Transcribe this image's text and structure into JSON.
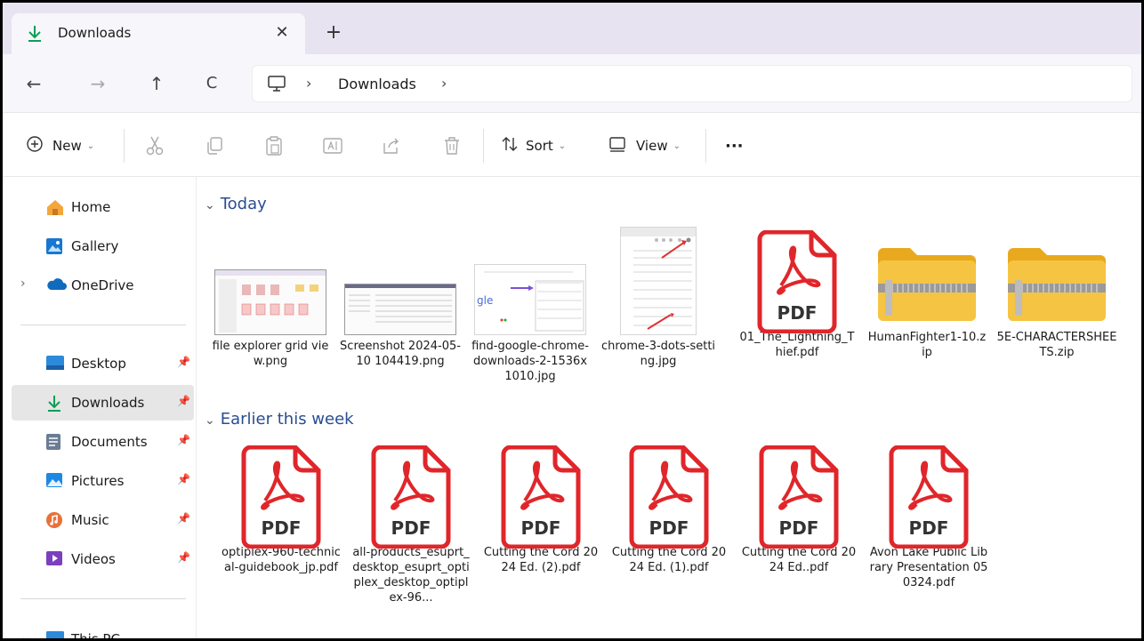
{
  "window": {
    "tab_label": "Downloads",
    "tab_close": "✕",
    "tab_new": "+"
  },
  "nav": {
    "back": "←",
    "forward": "→",
    "up": "↑",
    "refresh": "C",
    "address_segment": "Downloads",
    "chevron": "›"
  },
  "toolbar": {
    "new_label": "New",
    "sort_label": "Sort",
    "view_label": "View",
    "more_label": "···",
    "caret": "⌄"
  },
  "sidebar": {
    "items": [
      {
        "label": "Home",
        "icon": "home-icon"
      },
      {
        "label": "Gallery",
        "icon": "gallery-icon"
      },
      {
        "label": "OneDrive",
        "icon": "onedrive-icon"
      },
      {
        "label": "Desktop",
        "icon": "desktop-icon"
      },
      {
        "label": "Downloads",
        "icon": "downloads-icon"
      },
      {
        "label": "Documents",
        "icon": "documents-icon"
      },
      {
        "label": "Pictures",
        "icon": "pictures-icon"
      },
      {
        "label": "Music",
        "icon": "music-icon"
      },
      {
        "label": "Videos",
        "icon": "videos-icon"
      },
      {
        "label": "This PC",
        "icon": "this-pc-icon"
      }
    ]
  },
  "groups": {
    "today": {
      "title": "Today",
      "files": [
        {
          "name": "file explorer grid view.png",
          "type": "image"
        },
        {
          "name": "Screenshot 2024-05-10 104419.png",
          "type": "image"
        },
        {
          "name": "find-google-chrome-downloads-2-1536x1010.jpg",
          "type": "image"
        },
        {
          "name": "chrome-3-dots-setting.jpg",
          "type": "image"
        },
        {
          "name": "01_The_Lightning_Thief.pdf",
          "type": "pdf"
        },
        {
          "name": "HumanFighter1-10.zip",
          "type": "zip"
        },
        {
          "name": "5E-CHARACTERSHEETS.zip",
          "type": "zip"
        }
      ]
    },
    "earlier": {
      "title": "Earlier this week",
      "files": [
        {
          "name": "optiplex-960-technical-guidebook_jp.pdf",
          "type": "pdf"
        },
        {
          "name": "all-products_esuprt_desktop_esuprt_optiplex_desktop_optiplex-96...",
          "type": "pdf"
        },
        {
          "name": "Cutting the Cord 2024 Ed. (2).pdf",
          "type": "pdf"
        },
        {
          "name": "Cutting the Cord 2024 Ed. (1).pdf",
          "type": "pdf"
        },
        {
          "name": "Cutting the Cord 2024 Ed..pdf",
          "type": "pdf"
        },
        {
          "name": "Avon Lake Public Library Presentation 050324.pdf",
          "type": "pdf"
        }
      ]
    }
  },
  "pdf_badge": "PDF",
  "colors": {
    "accent": "#0f9d58",
    "pdf_red": "#e0262a",
    "folder_yellow": "#f6c443",
    "titlebar_bg": "#e8e3f1",
    "group_header": "#2a4d8f"
  }
}
